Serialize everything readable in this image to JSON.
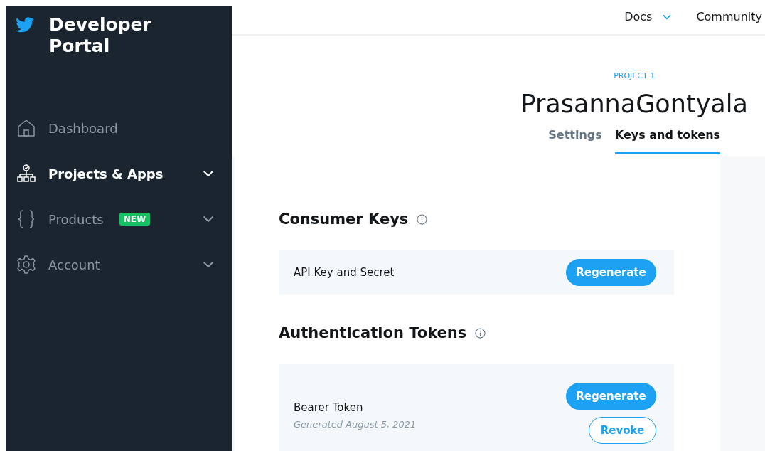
{
  "sidebar": {
    "brand": "Developer Portal",
    "items": [
      {
        "label": "Dashboard",
        "kind": "home",
        "selected": false,
        "expandable": false
      },
      {
        "label": "Projects & Apps",
        "kind": "projects",
        "selected": true,
        "expandable": true
      },
      {
        "label": "Products",
        "kind": "products",
        "selected": false,
        "expandable": true,
        "badge": "NEW"
      },
      {
        "label": "Account",
        "kind": "account",
        "selected": false,
        "expandable": true
      }
    ]
  },
  "top_nav": [
    {
      "label": "Docs",
      "dropdown": true
    },
    {
      "label": "Community",
      "dropdown": false
    }
  ],
  "header": {
    "eyebrow": "PROJECT 1",
    "title": "PrasannaGontyala",
    "tabs": [
      {
        "label": "Settings",
        "selected": false
      },
      {
        "label": "Keys and tokens",
        "selected": true
      }
    ]
  },
  "sections": [
    {
      "title": "Consumer Keys",
      "rows": [
        {
          "label": "API Key and Secret",
          "buttons": [
            {
              "label": "Regenerate",
              "kind": "primary"
            }
          ]
        }
      ]
    },
    {
      "title": "Authentication Tokens",
      "rows": [
        {
          "label": "Bearer Token",
          "note": "Generated August 5, 2021",
          "buttons": [
            {
              "label": "Regenerate",
              "kind": "primary"
            },
            {
              "label": "Revoke",
              "kind": "outline"
            }
          ]
        }
      ]
    }
  ]
}
